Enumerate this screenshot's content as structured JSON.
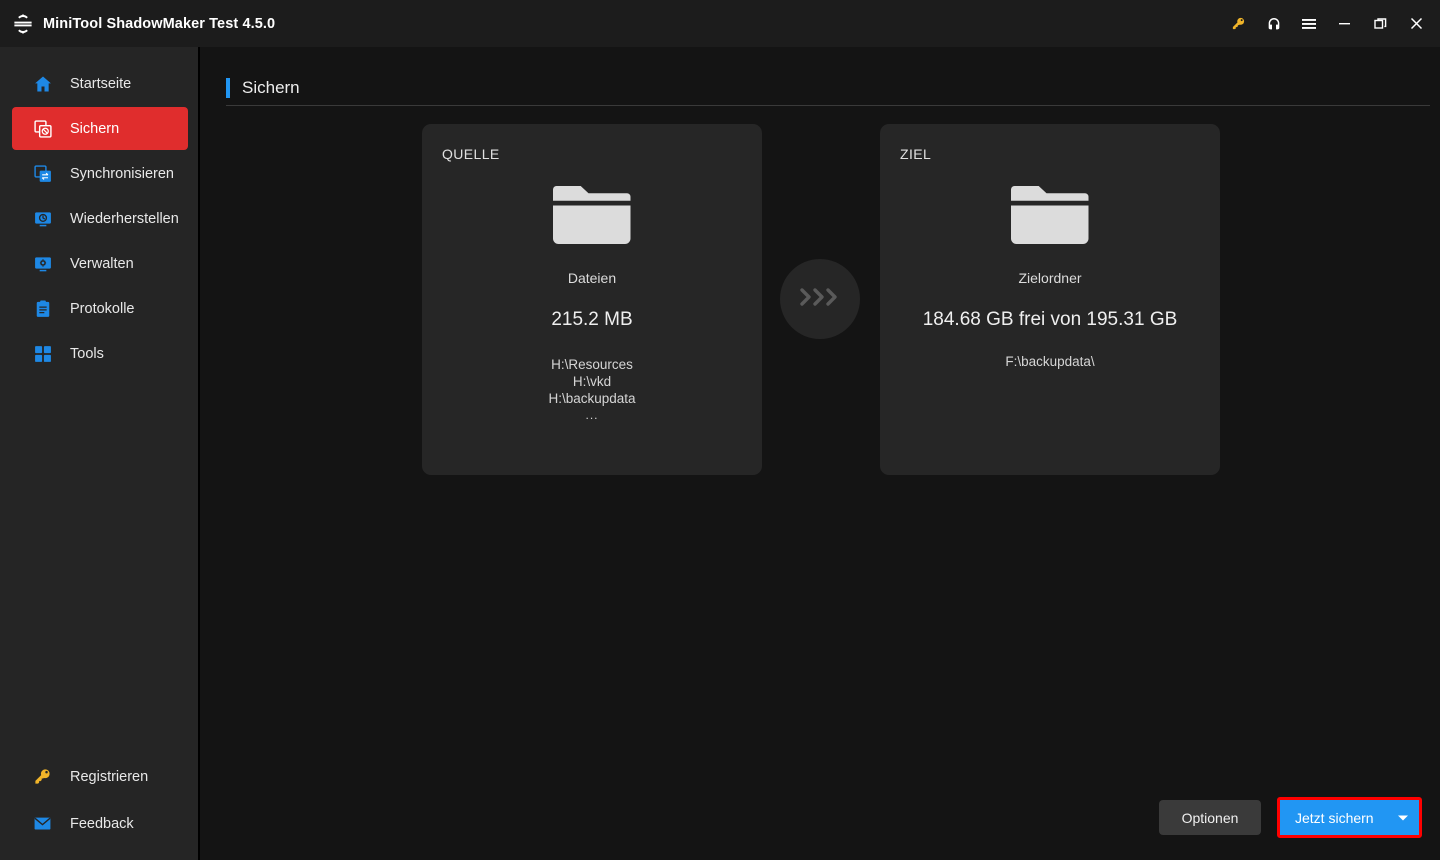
{
  "window": {
    "title": "MiniTool ShadowMaker Test 4.5.0",
    "logo_icon": "sync-circular-arrows-icon",
    "controls": [
      {
        "name": "register-key-icon",
        "label": "Registrieren"
      },
      {
        "name": "support-headset-icon",
        "label": "Support"
      },
      {
        "name": "hamburger-menu-icon",
        "label": "Menü"
      },
      {
        "name": "minimize-icon",
        "label": "Minimieren"
      },
      {
        "name": "restore-icon",
        "label": "Wiederherstellen"
      },
      {
        "name": "close-icon",
        "label": "Schließen"
      }
    ]
  },
  "sidebar": {
    "items": [
      {
        "label": "Startseite",
        "icon": "home-icon",
        "active": false
      },
      {
        "label": "Sichern",
        "icon": "backup-icon",
        "active": true
      },
      {
        "label": "Synchronisieren",
        "icon": "sync-icon",
        "active": false
      },
      {
        "label": "Wiederherstellen",
        "icon": "restore-monitor-icon",
        "active": false
      },
      {
        "label": "Verwalten",
        "icon": "manage-gear-monitor-icon",
        "active": false
      },
      {
        "label": "Protokolle",
        "icon": "logs-clipboard-icon",
        "active": false
      },
      {
        "label": "Tools",
        "icon": "tools-grid-icon",
        "active": false
      }
    ],
    "bottom_items": [
      {
        "label": "Registrieren",
        "icon": "key-icon"
      },
      {
        "label": "Feedback",
        "icon": "envelope-icon"
      }
    ]
  },
  "page": {
    "title": "Sichern"
  },
  "source_card": {
    "kicker": "QUELLE",
    "icon": "folder-icon",
    "type": "Dateien",
    "size": "215.2 MB",
    "paths": [
      "H:\\Resources",
      "H:\\vkd",
      "H:\\backupdata"
    ],
    "more": "..."
  },
  "arrow": {
    "icon": "chevrons-right-icon",
    "glyph": "❯❯❯"
  },
  "destination_card": {
    "kicker": "ZIEL",
    "icon": "folder-icon",
    "type": "Zielordner",
    "size": "184.68 GB frei von 195.31 GB",
    "path": "F:\\backupdata\\"
  },
  "footer": {
    "options_label": "Optionen",
    "backup_label": "Jetzt sichern",
    "backup_caret_icon": "caret-down-icon"
  },
  "colors": {
    "accent_blue": "#2196f3",
    "active_red": "#e02d2d",
    "highlight_red": "#ff0000",
    "key_gold": "#f0b429",
    "titlebar_bg": "#1c1c1c",
    "sidebar_bg": "#252525",
    "main_bg": "#141414",
    "card_bg": "#262626"
  }
}
